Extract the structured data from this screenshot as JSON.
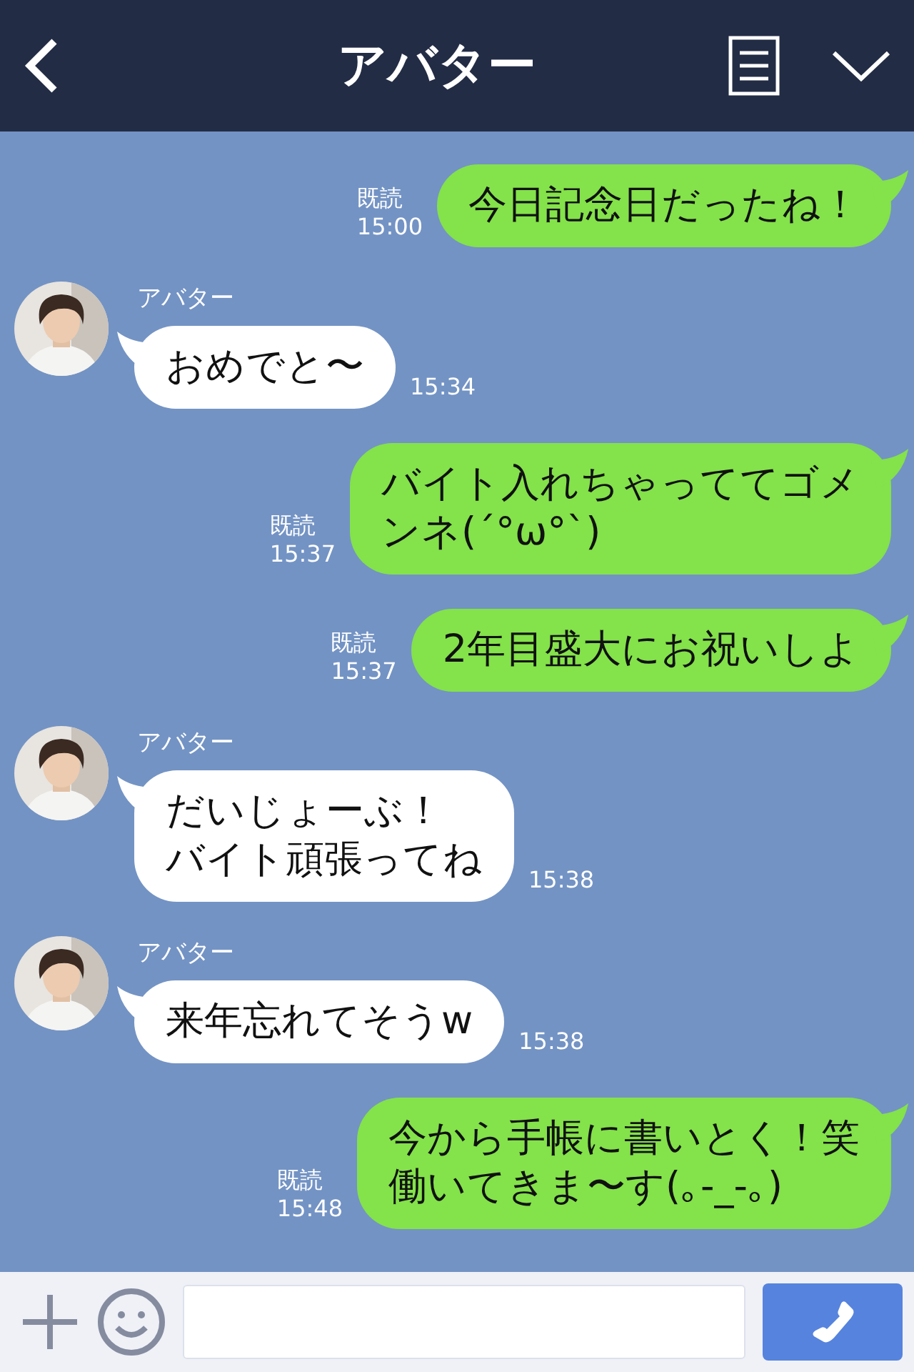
{
  "header": {
    "title": "アバター"
  },
  "messages": [
    {
      "kind": "sent",
      "lines": [
        "今日記念日だったね！"
      ],
      "read": "既読",
      "time": "15:00"
    },
    {
      "kind": "received",
      "sender": "アバター",
      "lines": [
        "おめでと〜"
      ],
      "time": "15:34"
    },
    {
      "kind": "sent",
      "lines": [
        "バイト入れちゃっててゴメ",
        "ンネ(´°ω°`)"
      ],
      "read": "既読",
      "time": "15:37"
    },
    {
      "kind": "sent",
      "lines": [
        "2年目盛大にお祝いしよ"
      ],
      "read": "既読",
      "time": "15:37"
    },
    {
      "kind": "received",
      "sender": "アバター",
      "lines": [
        "だいじょーぶ！",
        "バイト頑張ってね"
      ],
      "time": "15:38"
    },
    {
      "kind": "received",
      "sender": "アバター",
      "lines": [
        "来年忘れてそうw"
      ],
      "time": "15:38"
    },
    {
      "kind": "sent",
      "lines": [
        "今から手帳に書いとく！笑",
        "働いてきま〜す(｡-_-｡)"
      ],
      "read": "既読",
      "time": "15:48"
    }
  ]
}
